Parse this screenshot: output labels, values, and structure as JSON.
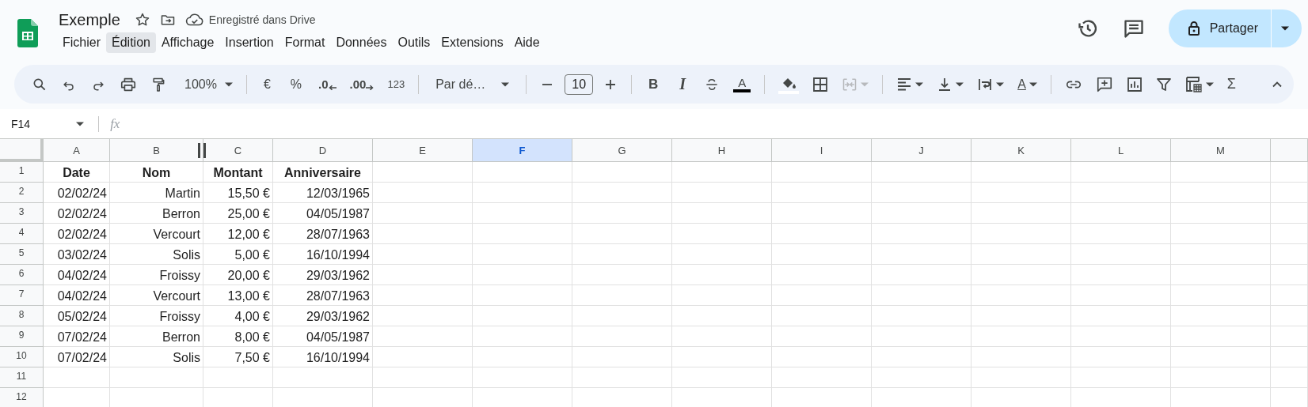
{
  "document": {
    "title": "Exemple",
    "save_status": "Enregistré dans Drive"
  },
  "menu": [
    {
      "label": "Fichier",
      "selected": false
    },
    {
      "label": "Édition",
      "selected": true
    },
    {
      "label": "Affichage",
      "selected": false
    },
    {
      "label": "Insertion",
      "selected": false
    },
    {
      "label": "Format",
      "selected": false
    },
    {
      "label": "Données",
      "selected": false
    },
    {
      "label": "Outils",
      "selected": false
    },
    {
      "label": "Extensions",
      "selected": false
    },
    {
      "label": "Aide",
      "selected": false
    }
  ],
  "share_button": {
    "label": "Partager"
  },
  "toolbar": {
    "zoom": "100%",
    "currency": "€",
    "percent": "%",
    "decrease_decimals": ".0",
    "increase_decimals": ".00",
    "number_format": "123",
    "font": "Par dé…",
    "font_size": "10",
    "bold": "B",
    "italic": "I",
    "text_color": "A",
    "text_rotation": "A",
    "functions": "Σ",
    "merge_disabled": true
  },
  "formula_bar": {
    "cell_reference": "F14",
    "formula_label": "fx"
  },
  "columns": [
    {
      "label": "A",
      "selected": false
    },
    {
      "label": "B",
      "selected": false
    },
    {
      "label": "C",
      "selected": false
    },
    {
      "label": "D",
      "selected": false
    },
    {
      "label": "E",
      "selected": false
    },
    {
      "label": "F",
      "selected": true
    },
    {
      "label": "G",
      "selected": false
    },
    {
      "label": "H",
      "selected": false
    },
    {
      "label": "I",
      "selected": false
    },
    {
      "label": "J",
      "selected": false
    },
    {
      "label": "K",
      "selected": false
    },
    {
      "label": "L",
      "selected": false
    },
    {
      "label": "M",
      "selected": false
    }
  ],
  "rows": [
    {
      "number": "1",
      "kind": "header",
      "cells": [
        "Date",
        "Nom",
        "Montant",
        "Anniversaire"
      ]
    },
    {
      "number": "2",
      "kind": "data",
      "cells": [
        "02/02/24",
        "Martin",
        "15,50 €",
        "12/03/1965"
      ]
    },
    {
      "number": "3",
      "kind": "data",
      "cells": [
        "02/02/24",
        "Berron",
        "25,00 €",
        "04/05/1987"
      ]
    },
    {
      "number": "4",
      "kind": "data",
      "cells": [
        "02/02/24",
        "Vercourt",
        "12,00 €",
        "28/07/1963"
      ]
    },
    {
      "number": "5",
      "kind": "data",
      "cells": [
        "03/02/24",
        "Solis",
        "5,00 €",
        "16/10/1994"
      ]
    },
    {
      "number": "6",
      "kind": "data",
      "cells": [
        "04/02/24",
        "Froissy",
        "20,00 €",
        "29/03/1962"
      ]
    },
    {
      "number": "7",
      "kind": "data",
      "cells": [
        "04/02/24",
        "Vercourt",
        "13,00 €",
        "28/07/1963"
      ]
    },
    {
      "number": "8",
      "kind": "data",
      "cells": [
        "05/02/24",
        "Froissy",
        "4,00 €",
        "29/03/1962"
      ]
    },
    {
      "number": "9",
      "kind": "data",
      "cells": [
        "07/02/24",
        "Berron",
        "8,00 €",
        "04/05/1987"
      ]
    },
    {
      "number": "10",
      "kind": "data",
      "cells": [
        "07/02/24",
        "Solis",
        "7,50 €",
        "16/10/1994"
      ]
    },
    {
      "number": "11"
    },
    {
      "number": "12"
    }
  ]
}
